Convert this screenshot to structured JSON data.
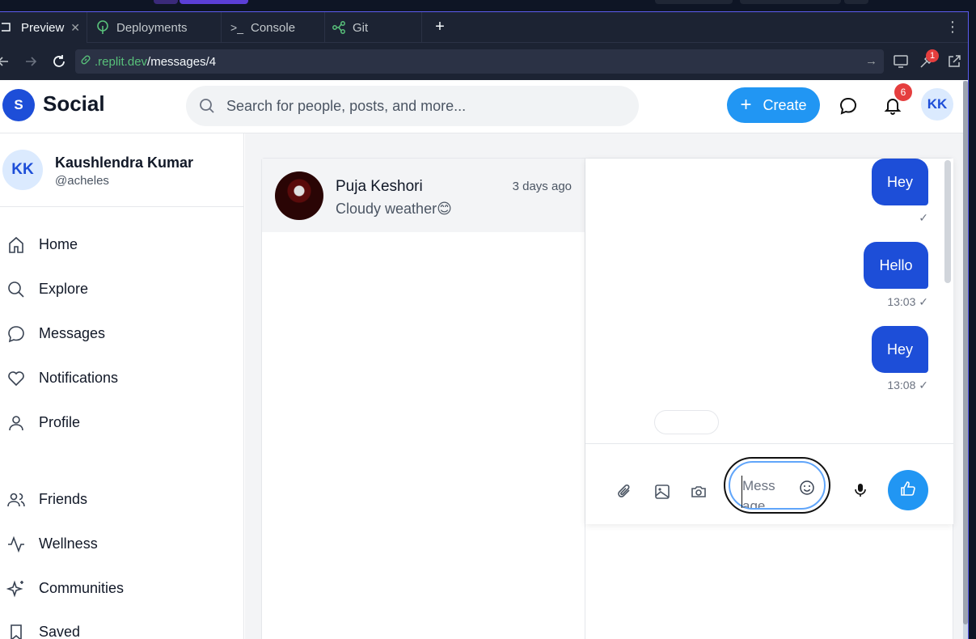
{
  "browser": {
    "tabs": [
      {
        "label": "Preview",
        "icon": "monitor-icon"
      },
      {
        "label": "Deployments",
        "icon": "tree-icon"
      },
      {
        "label": "Console",
        "icon": "terminal-icon"
      },
      {
        "label": "Git",
        "icon": "git-branch-icon"
      }
    ],
    "add_tab": "+",
    "url": {
      "host": ".replit.dev",
      "path": "/messages/4"
    },
    "tools_badge": "1"
  },
  "app": {
    "logo_letter": "S",
    "name": "Social",
    "search_placeholder": "Search for people, posts, and more...",
    "create_label": "Create",
    "notification_count": "6",
    "user_initials": "KK"
  },
  "profile": {
    "initials": "KK",
    "name": "Kaushlendra Kumar",
    "handle": "@acheles"
  },
  "nav": {
    "items": [
      {
        "label": "Home",
        "icon": "home-icon"
      },
      {
        "label": "Explore",
        "icon": "search-icon"
      },
      {
        "label": "Messages",
        "icon": "message-icon"
      },
      {
        "label": "Notifications",
        "icon": "heart-icon"
      },
      {
        "label": "Profile",
        "icon": "user-icon"
      },
      {
        "label": "Friends",
        "icon": "users-icon"
      },
      {
        "label": "Wellness",
        "icon": "activity-icon"
      },
      {
        "label": "Communities",
        "icon": "sparkles-icon"
      },
      {
        "label": "Saved",
        "icon": "bookmark-icon"
      }
    ]
  },
  "conversations": [
    {
      "name": "Puja Keshori",
      "time": "3 days ago",
      "preview": "Cloudy weather😊"
    }
  ],
  "messages": [
    {
      "text": "Hey",
      "time": "",
      "status": "✓"
    },
    {
      "text": "Hello",
      "time": "13:03",
      "status": "✓"
    },
    {
      "text": "Hey",
      "time": "13:08",
      "status": "✓"
    }
  ],
  "composer": {
    "placeholder": "Message"
  },
  "colors": {
    "accent": "#2196f3",
    "bubble": "#1d4ed8",
    "notification_badge": "#e53e3e"
  }
}
